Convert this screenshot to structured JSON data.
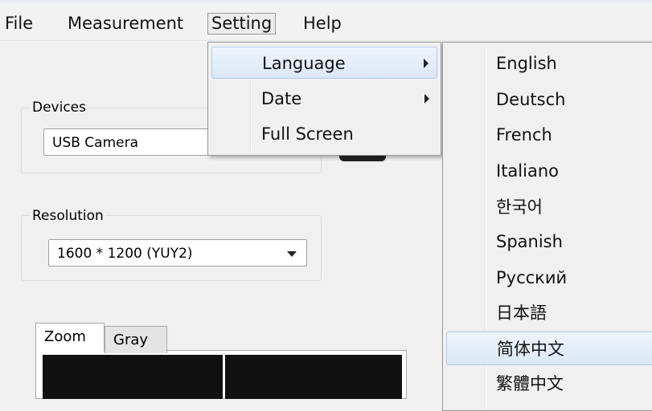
{
  "menubar": {
    "items": [
      {
        "label": "File"
      },
      {
        "label": "Measurement"
      },
      {
        "label": "Setting"
      },
      {
        "label": "Help"
      }
    ]
  },
  "devices": {
    "group_label": "Devices",
    "selected": "USB Camera"
  },
  "resolution": {
    "group_label": "Resolution",
    "selected": "1600 * 1200  (YUY2)"
  },
  "tabs": [
    {
      "label": "Zoom",
      "active": true
    },
    {
      "label": "Gray",
      "active": false
    }
  ],
  "setting_menu": {
    "items": [
      {
        "label": "Language",
        "has_submenu": true,
        "highlighted": true
      },
      {
        "label": "Date",
        "has_submenu": true,
        "highlighted": false
      },
      {
        "label": "Full Screen",
        "has_submenu": false,
        "highlighted": false
      }
    ]
  },
  "language_menu": {
    "items": [
      {
        "label": "English"
      },
      {
        "label": "Deutsch"
      },
      {
        "label": "French"
      },
      {
        "label": "Italiano"
      },
      {
        "label": "한국어"
      },
      {
        "label": "Spanish"
      },
      {
        "label": "Русский"
      },
      {
        "label": "日本語"
      },
      {
        "label": "简体中文",
        "highlighted": true
      },
      {
        "label": "繁體中文"
      }
    ]
  }
}
